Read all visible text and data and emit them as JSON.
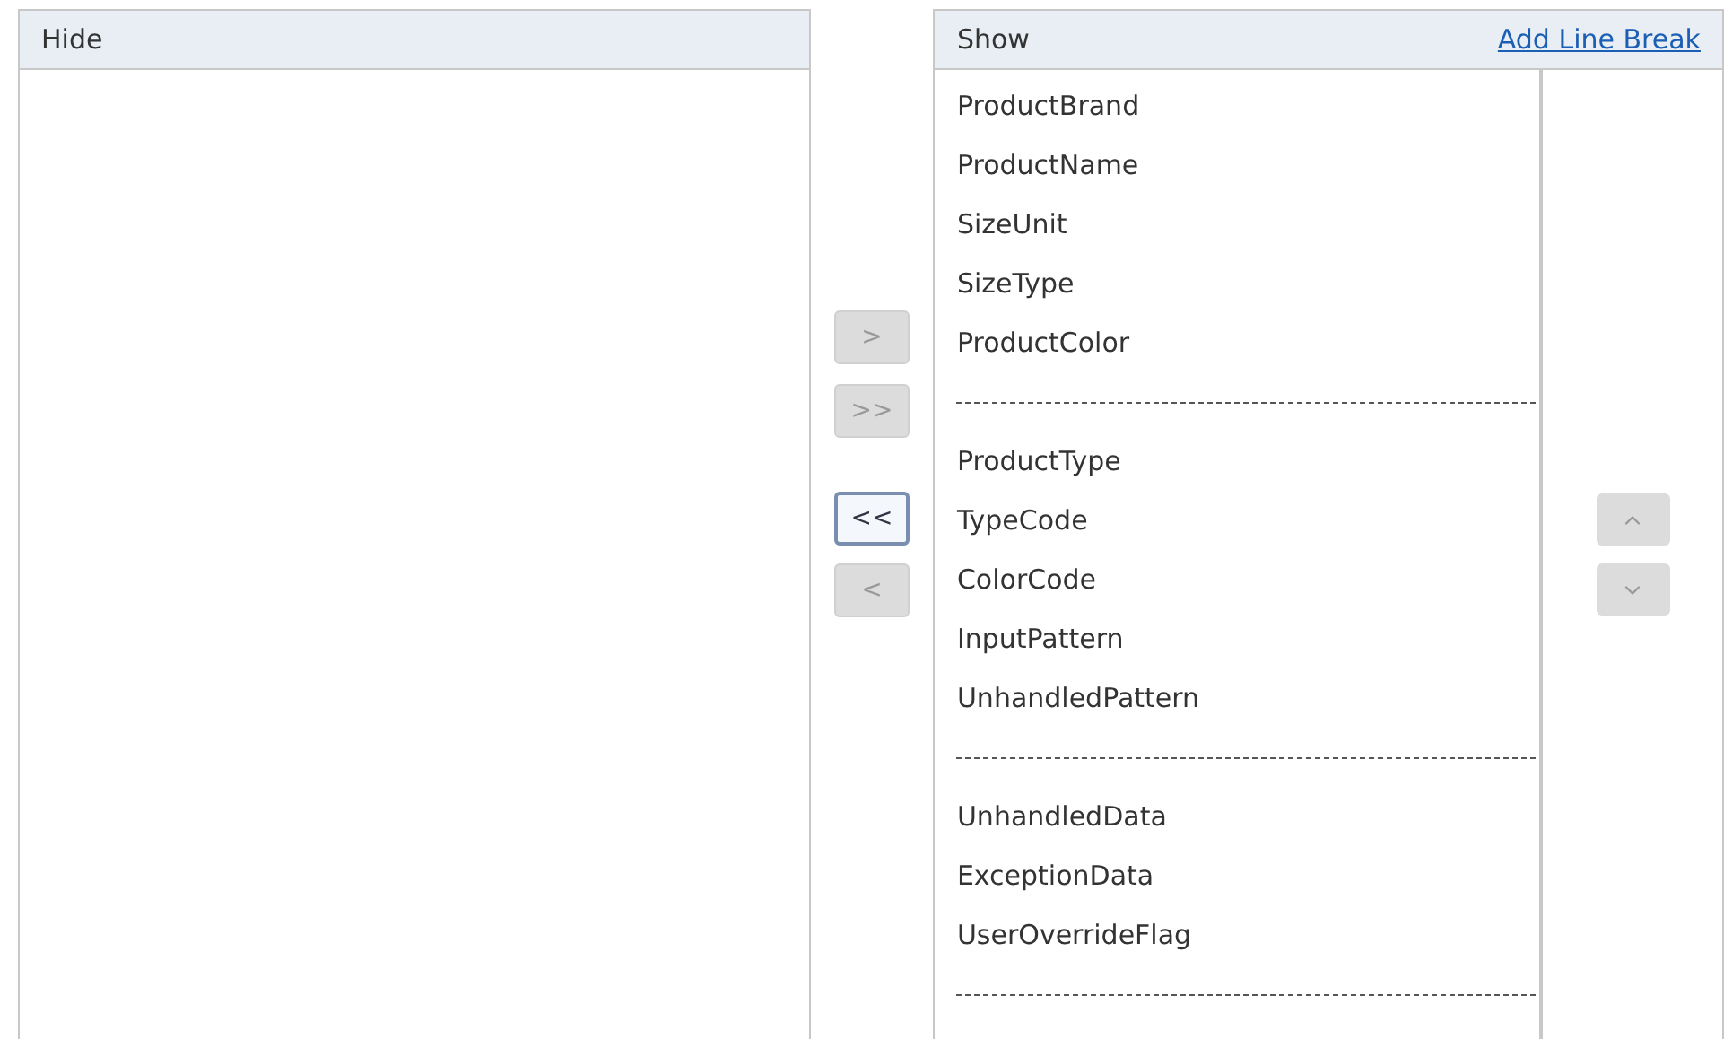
{
  "hide_panel": {
    "title": "Hide"
  },
  "move_buttons": [
    {
      "label": ">",
      "disabled": true
    },
    {
      "label": ">>",
      "disabled": true
    },
    {
      "label": "<<",
      "disabled": false
    },
    {
      "label": "<",
      "disabled": true
    }
  ],
  "show_panel": {
    "title": "Show",
    "link": "Add Line Break",
    "items": [
      {
        "kind": "field",
        "label": "ProductBrand"
      },
      {
        "kind": "field",
        "label": "ProductName"
      },
      {
        "kind": "field",
        "label": "SizeUnit"
      },
      {
        "kind": "field",
        "label": "SizeType"
      },
      {
        "kind": "field",
        "label": "ProductColor"
      },
      {
        "kind": "separator"
      },
      {
        "kind": "field",
        "label": "ProductType"
      },
      {
        "kind": "field",
        "label": "TypeCode"
      },
      {
        "kind": "field",
        "label": "ColorCode"
      },
      {
        "kind": "field",
        "label": "InputPattern"
      },
      {
        "kind": "field",
        "label": "UnhandledPattern"
      },
      {
        "kind": "separator"
      },
      {
        "kind": "field",
        "label": "UnhandledData"
      },
      {
        "kind": "field",
        "label": "ExceptionData"
      },
      {
        "kind": "field",
        "label": "UserOverrideFlag"
      },
      {
        "kind": "separator"
      }
    ]
  },
  "order_buttons": [
    {
      "kind": "up",
      "disabled": true
    },
    {
      "kind": "down",
      "disabled": true
    }
  ]
}
